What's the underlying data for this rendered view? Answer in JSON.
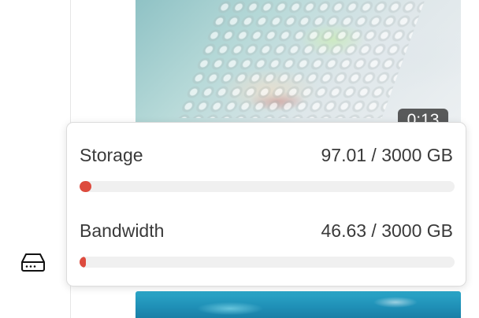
{
  "video": {
    "duration": "0:13"
  },
  "usage": [
    {
      "label": "Storage",
      "value_text": "97.01 / 3000 GB",
      "used": 97.01,
      "total": 3000
    },
    {
      "label": "Bandwidth",
      "value_text": "46.63 / 3000 GB",
      "used": 46.63,
      "total": 3000
    }
  ],
  "colors": {
    "bar_fill": "#dd4b3e",
    "bar_track": "#f0f0f0"
  },
  "icons": {
    "sidebar": "hard-drive-icon"
  }
}
